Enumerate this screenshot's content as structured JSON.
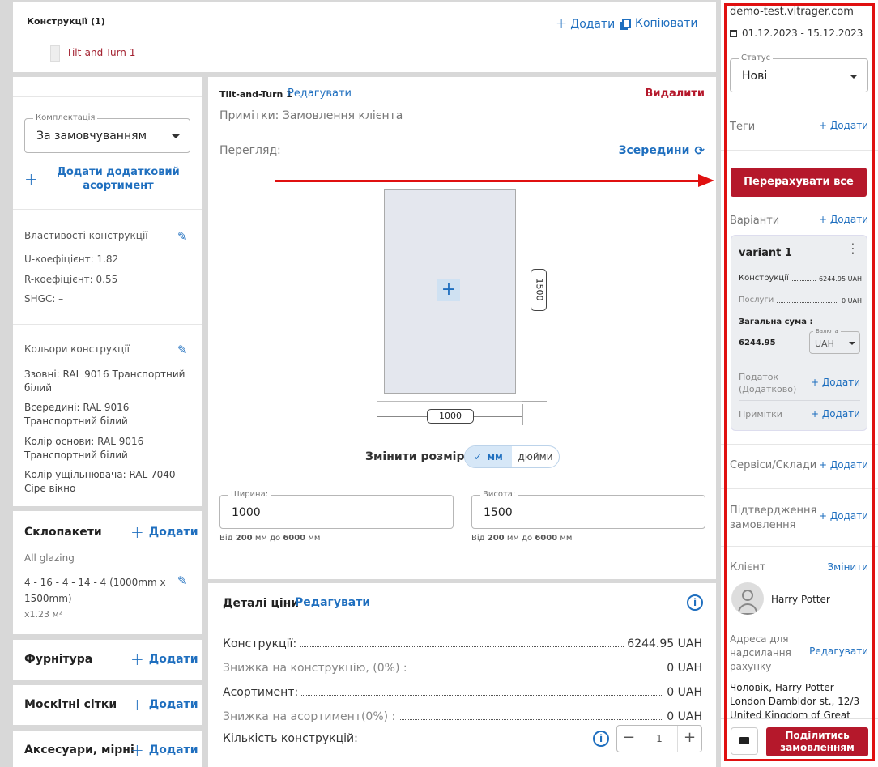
{
  "top": {
    "constructions_title": "Конструкції (1)",
    "add_label": "Додати",
    "copy_label": "Копіювати",
    "item_name": "Tilt-and-Turn 1"
  },
  "left": {
    "komplektatsia_legend": "Комплектація",
    "komplektatsia_value": "За замовчуванням",
    "add_assortment": "Додати додатковий асортимент",
    "props_title": "Властивості конструкції",
    "u_coef": "U-коефіцієнт: 1.82",
    "r_coef": "R-коефіцієнт: 0.55",
    "shgc": "SHGC: –",
    "colors_title": "Кольори конструкції",
    "color_out": "Ззовні: RAL 9016 Транспортний білий",
    "color_in": "Всередині: RAL 9016 Транспортний білий",
    "color_base": "Колір основи: RAL 9016 Транспортний білий",
    "color_seal": "Колір ущільнювача: RAL 7040 Сіре вікно",
    "glazing_title": "Склопакети",
    "glazing_add": "Додати",
    "glazing_all": "All glazing",
    "glazing_spec": "4 - 16 - 4 - 14 - 4 (1000mm x 1500mm)",
    "glazing_area": "x1.23 м²",
    "hardware_title": "Фурнітура",
    "hardware_add": "Додати",
    "screens_title": "Москітні сітки",
    "screens_add": "Додати",
    "acc_title": "Аксесуари, мірні",
    "acc_add": "Додати"
  },
  "center": {
    "item_name": "Tilt-and-Turn 1",
    "edit": "Редагувати",
    "delete": "Видалити",
    "notes": "Примітки: Замовлення клієнта",
    "view_label": "Перегляд:",
    "view_value": "Зсередини",
    "height_dim": "1500",
    "width_dim": "1000",
    "resize_label": "Змінити розмір",
    "unit_mm": "мм",
    "unit_in": "дюйми",
    "width_legend": "Ширина:",
    "width_value": "1000",
    "height_legend": "Висота:",
    "height_value": "1500",
    "range_prefix": "Від",
    "range_min": "200",
    "range_mid": "мм до",
    "range_max": "6000",
    "range_unit": "мм"
  },
  "price": {
    "title": "Деталі ціни",
    "edit": "Редагувати",
    "rows": [
      {
        "label": "Конструкції:",
        "value": "6244.95 UAH"
      },
      {
        "label": "Знижка на конструкцію, (0%) :",
        "value": "0 UAH"
      },
      {
        "label": "Асортимент:",
        "value": "0 UAH"
      },
      {
        "label": "Знижка на асортимент(0%) :",
        "value": "0 UAH"
      }
    ],
    "qty_label": "Кількість конструкцій:",
    "qty_value": "1"
  },
  "right": {
    "domain": "demo-test.vitrager.com",
    "dates": "01.12.2023 - 15.12.2023",
    "status_legend": "Статус",
    "status_value": "Нові",
    "tags": "Теги",
    "add": "+ Додати",
    "recalc": "Перерахувати все",
    "variants": "Варіанти",
    "variant_name": "variant 1",
    "v_constructions": "Конструкції",
    "v_constructions_val": "6244.95 UAH",
    "v_services": "Послуги",
    "v_services_val": "0 UAH",
    "total_label": "Загальна сума :",
    "total_value": "6244.95",
    "currency_legend": "Валюта",
    "currency_value": "UAH",
    "tax": "Податок (Додатково)",
    "notes": "Примітки",
    "services": "Сервіси/Склади",
    "confirm": "Підтвердження замовлення",
    "client": "Клієнт",
    "change": "Змінити",
    "client_name": "Harry Potter",
    "address_label": "Адреса для надсилання рахунку",
    "edit": "Редагувати",
    "address_text": "Чоловік, Harry Potter London Dambldor st., 12/3 United Kingdom of Great",
    "share": "Поділитись замовленням"
  },
  "colors": {
    "accent": "#b5182b",
    "link": "#1f6fbf",
    "annotation": "#e01010"
  }
}
